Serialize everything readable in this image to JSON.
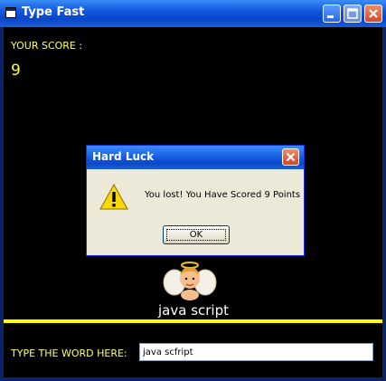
{
  "window": {
    "title": "Type Fast"
  },
  "game": {
    "score_label": "YOUR SCORE :",
    "score_value": "9",
    "current_word": "java script",
    "type_label": "TYPE THE WORD HERE:",
    "typed_value": "java scfript"
  },
  "dialog": {
    "title": "Hard Luck",
    "message": "You lost! You Have Scored 9 Points",
    "ok_label": "OK"
  },
  "icons": {
    "window": "app-window-icon",
    "minimize": "minimize-icon",
    "maximize": "maximize-icon",
    "close": "close-icon",
    "warning": "warning-icon",
    "angel": "angel-image"
  },
  "colors": {
    "background": "#000000",
    "label_yellow": "#ffff66",
    "separator": "#ffff00",
    "titlebar_blue": "#0a46c8",
    "dialog_bg": "#ece9d8"
  }
}
